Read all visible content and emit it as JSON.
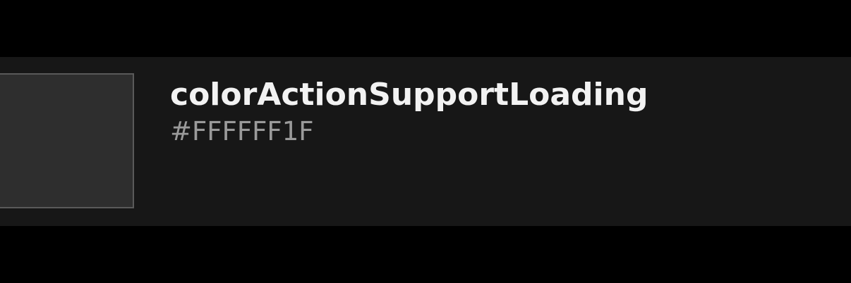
{
  "token": {
    "name": "colorActionSupportLoading",
    "value": "#FFFFFF1F"
  },
  "colors": {
    "page_background": "#000000",
    "row_background": "#171717",
    "swatch_fill": "#2E2E2E",
    "swatch_border": "#5A5A5A",
    "name_text": "#F2F2F2",
    "value_text": "#9A9A9A"
  }
}
